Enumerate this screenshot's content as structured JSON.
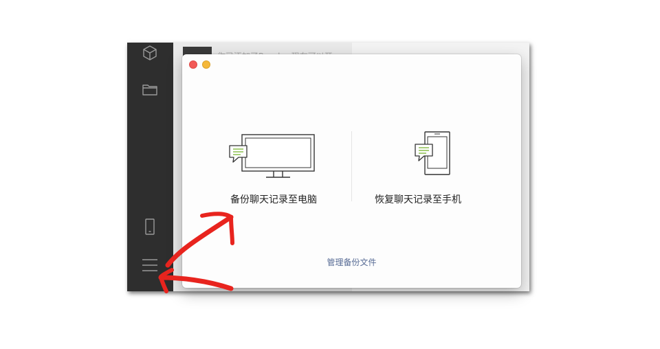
{
  "chat_preview": {
    "text": "你已添加了Peach，现在可以开"
  },
  "sidebar": {
    "icons": [
      "cube-icon",
      "folder-icon",
      "phone-icon",
      "menu-icon"
    ]
  },
  "dialog": {
    "backup_label": "备份聊天记录至电脑",
    "restore_label": "恢复聊天记录至手机",
    "manage_label": "管理备份文件"
  },
  "colors": {
    "close": "#f25a57",
    "minimize": "#f5b83a",
    "link": "#576b95",
    "bubble": "#8bbf4e",
    "annotation": "#e8241e"
  }
}
